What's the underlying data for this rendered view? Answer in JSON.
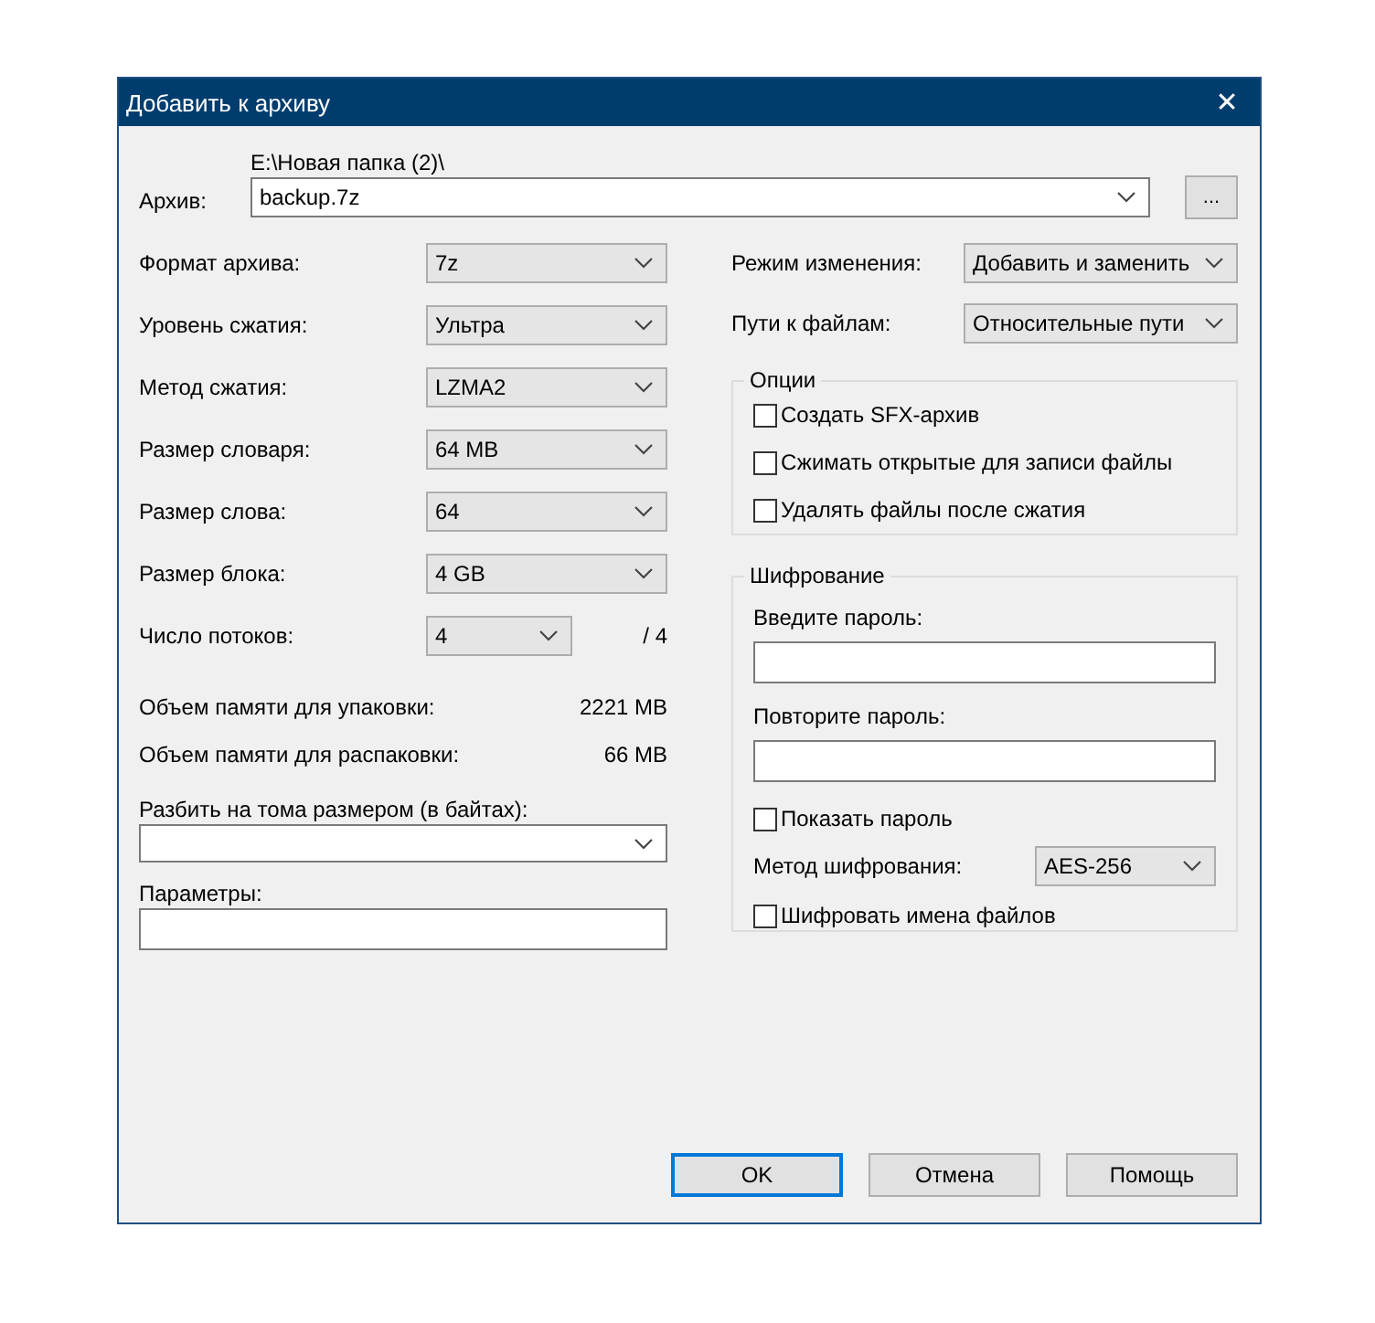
{
  "window": {
    "title": "Добавить к архиву",
    "close": "✕"
  },
  "archive": {
    "label": "Архив:",
    "path": "E:\\Новая папка (2)\\",
    "value": "backup.7z",
    "browse": "..."
  },
  "settings": [
    {
      "label": "Формат архива:",
      "value": "7z"
    },
    {
      "label": "Уровень сжатия:",
      "value": "Ультра"
    },
    {
      "label": "Метод сжатия:",
      "value": "LZMA2"
    },
    {
      "label": "Размер словаря:",
      "value": "64 MB"
    },
    {
      "label": "Размер слова:",
      "value": "64"
    },
    {
      "label": "Размер блока:",
      "value": "4 GB"
    }
  ],
  "threads": {
    "label": "Число потоков:",
    "value": "4",
    "max": "/ 4"
  },
  "memory": [
    {
      "label": "Объем памяти для упаковки:",
      "value": "2221 MB"
    },
    {
      "label": "Объем памяти для распаковки:",
      "value": "66 MB"
    }
  ],
  "split": {
    "label": "Разбить на тома размером (в байтах):"
  },
  "parameters": {
    "label": "Параметры:"
  },
  "modes": [
    {
      "label": "Режим изменения:",
      "value": "Добавить и заменить"
    },
    {
      "label": "Пути к файлам:",
      "value": "Относительные пути"
    }
  ],
  "options": {
    "title": "Опции",
    "items": [
      {
        "label": "Создать SFX-архив",
        "checked": false
      },
      {
        "label": "Сжимать открытые для записи файлы",
        "checked": false
      },
      {
        "label": "Удалять файлы после сжатия",
        "checked": false
      }
    ]
  },
  "encryption": {
    "title": "Шифрование",
    "password_label": "Введите пароль:",
    "repeat_label": "Повторите пароль:",
    "show": {
      "label": "Показать пароль",
      "checked": false
    },
    "method": {
      "label": "Метод шифрования:",
      "value": "AES-256"
    },
    "encrypt_names": {
      "label": "Шифровать имена файлов",
      "checked": false
    }
  },
  "buttons": [
    {
      "label": "OK",
      "default": true
    },
    {
      "label": "Отмена",
      "default": false
    },
    {
      "label": "Помощь",
      "default": false
    }
  ]
}
